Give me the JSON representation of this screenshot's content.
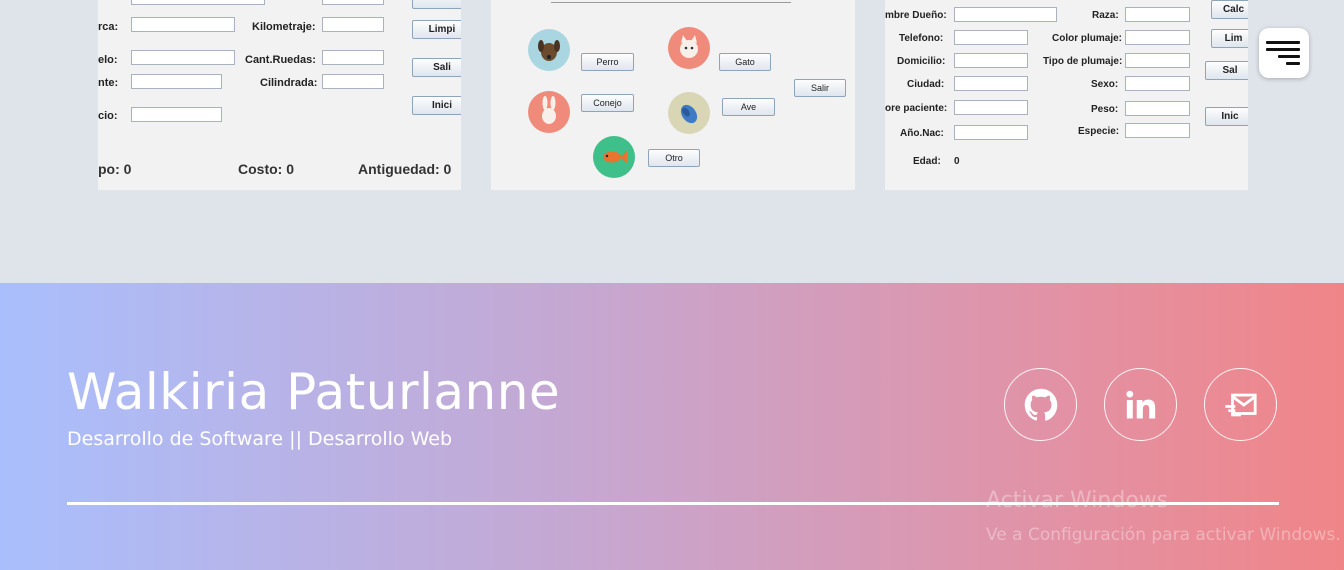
{
  "vehicle_form": {
    "labels": {
      "marca": "rca:",
      "kilometraje": "Kilometraje:",
      "modelo": "elo:",
      "cant_ruedas": "Cant.Ruedas:",
      "cliente": "nte:",
      "cilindrada": "Cilindrada:",
      "precio": "cio:"
    },
    "buttons": {
      "limpiar": "Limpi",
      "salir": "Sali",
      "inicio": "Inici"
    },
    "stats": {
      "tipo": "po:  0",
      "costo": "Costo: 0",
      "antiguedad": "Antiguedad: 0"
    }
  },
  "animal_menu": {
    "buttons": {
      "perro": "Perro",
      "gato": "Gato",
      "conejo": "Conejo",
      "ave": "Ave",
      "otro": "Otro",
      "salir": "Salir"
    }
  },
  "patient_form": {
    "labels": {
      "nombre_dueno": "mbre Dueño:",
      "telefono": "Telefono:",
      "domicilio": "Domicilio:",
      "ciudad": "Ciudad:",
      "nombre_paciente": "ore paciente:",
      "anio_nac": "Año.Nac:",
      "edad": "Edad:",
      "edad_value": "0",
      "raza": "Raza:",
      "color_plumaje": "Color plumaje:",
      "tipo_plumaje": "Tipo de plumaje:",
      "sexo": "Sexo:",
      "peso": "Peso:",
      "especie": "Especie:"
    },
    "buttons": {
      "calcular": "Calc",
      "limpiar": "Lim",
      "salir": "Sal",
      "inicio": "Inic"
    }
  },
  "footer": {
    "name": "Walkiria Paturlanne",
    "tagline": "Desarrollo de Software || Desarrollo Web",
    "social": [
      "github-icon",
      "linkedin-icon",
      "email-icon"
    ]
  },
  "watermark": {
    "line1": "Activar Windows",
    "line2": "Ve a Configuración para activar Windows."
  }
}
